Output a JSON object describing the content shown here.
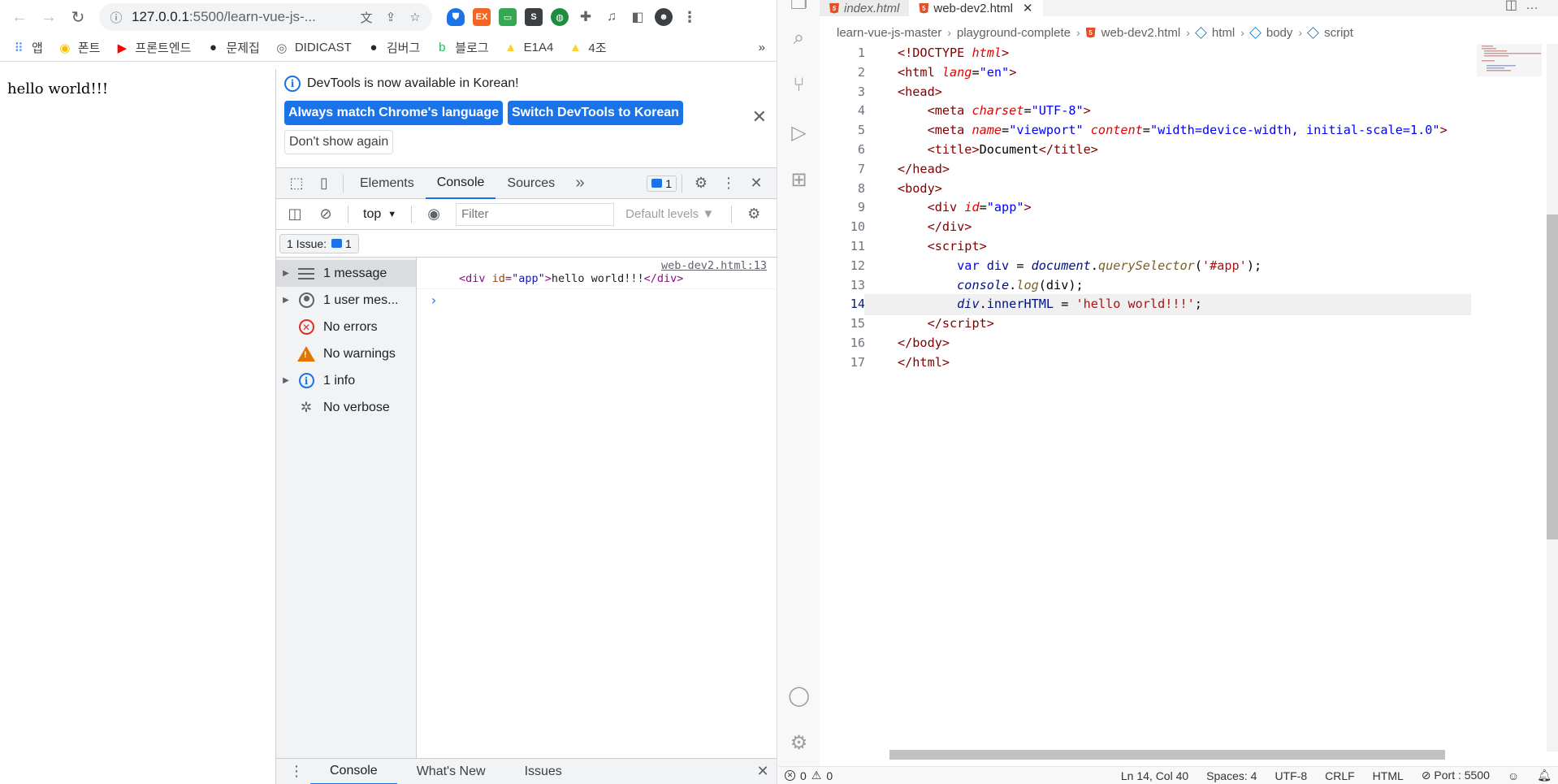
{
  "chrome": {
    "url_host": "127.0.0.1",
    "url_path": ":5500/learn-vue-js-...",
    "bookmarks": [
      {
        "label": "앱",
        "icon": "apps-grid-icon",
        "color": "#4285f4"
      },
      {
        "label": "폰트",
        "icon": "duck-icon",
        "color": "#fbbc04"
      },
      {
        "label": "프론트엔드",
        "icon": "youtube-icon",
        "color": "#ff0000"
      },
      {
        "label": "문제집",
        "icon": "github-icon",
        "color": "#24292f"
      },
      {
        "label": "DIDICAST",
        "icon": "globe-icon",
        "color": "#5f6368"
      },
      {
        "label": "김버그",
        "icon": "github-icon",
        "color": "#24292f"
      },
      {
        "label": "블로그",
        "icon": "blog-icon",
        "color": "#03c75a"
      },
      {
        "label": "E1A4",
        "icon": "miro-icon",
        "color": "#ffd02f"
      },
      {
        "label": "4조",
        "icon": "miro-icon",
        "color": "#ffd02f"
      }
    ],
    "more_bookmarks": "»"
  },
  "page": {
    "text": "hello world!!!"
  },
  "devtools": {
    "infobar": {
      "message": "DevTools is now available in Korean!",
      "btn_match": "Always match Chrome's language",
      "btn_switch": "Switch DevTools to Korean",
      "btn_dismiss": "Don't show again"
    },
    "tabs": [
      "Elements",
      "Console",
      "Sources"
    ],
    "more_tabs": "»",
    "issue_badge_count": "1",
    "context": "top",
    "filter_placeholder": "Filter",
    "levels": "Default levels",
    "issues_label": "1 Issue:",
    "issues_count": "1",
    "sidebar": [
      {
        "label": "1 message",
        "expandable": true
      },
      {
        "label": "1 user mes...",
        "expandable": true
      },
      {
        "label": "No errors",
        "expandable": false
      },
      {
        "label": "No warnings",
        "expandable": false
      },
      {
        "label": "1 info",
        "expandable": true
      },
      {
        "label": "No verbose",
        "expandable": false
      }
    ],
    "log": {
      "source": "web-dev2.html:13",
      "tag_open": "<div",
      "attr_name": "id",
      "attr_value": "\"app\"",
      "content": "hello world!!!",
      "tag_close": "</div>"
    },
    "drawer_tabs": [
      "Console",
      "What's New",
      "Issues"
    ]
  },
  "vscode": {
    "tabs": [
      {
        "label": "index.html",
        "active": false
      },
      {
        "label": "web-dev2.html",
        "active": true
      }
    ],
    "breadcrumb": [
      "learn-vue-js-master",
      "playground-complete",
      "web-dev2.html",
      "html",
      "body",
      "script"
    ],
    "current_line": 14,
    "status": {
      "errors": "0",
      "warnings": "0",
      "position": "Ln 14, Col 40",
      "spaces": "Spaces: 4",
      "encoding": "UTF-8",
      "eol": "CRLF",
      "language": "HTML",
      "port": "Port : 5500"
    }
  }
}
